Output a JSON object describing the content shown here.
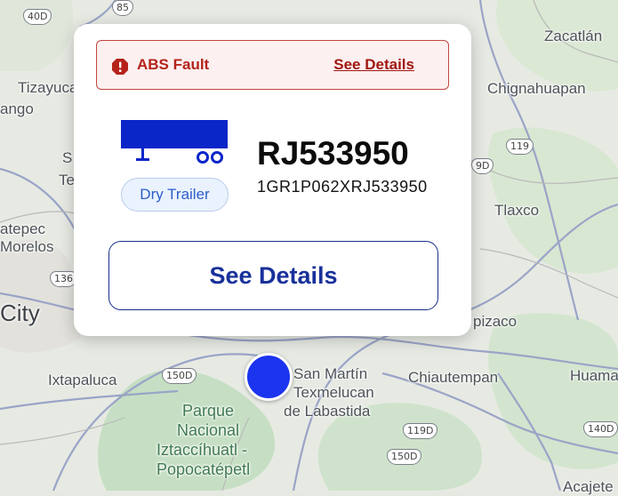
{
  "map": {
    "labels": {
      "tizayuca": "Tizayuca",
      "ango": "ango",
      "ecatepec": "atepec",
      "morelos": "Morelos",
      "city": "City",
      "te": "Te",
      "s": "S",
      "ixtapaluca": "Ixtapaluca",
      "park_line1": "Parque",
      "park_line2": "Nacional",
      "park_line3": "Iztaccíhuatl -",
      "park_line4": "Popocatépetl",
      "san_martin_line1": "San Martín",
      "san_martin_line2": "Texmelucan",
      "san_martin_line3": "de Labastida",
      "chiautempan": "Chiautempan",
      "huamantla": "Huaman",
      "tlaxco": "Tlaxco",
      "chignahuapan": "Chignahuapan",
      "zacatlan": "Zacatlán",
      "apizaco": "pizaco",
      "acajete": "Acajete"
    },
    "shields": {
      "s40d": "40D",
      "s85": "85",
      "s119a": "119",
      "s119d": "119D",
      "s150d_a": "150D",
      "s150d_b": "150D",
      "s140d": "140D",
      "s136": "136",
      "s9d": "9D"
    }
  },
  "alert": {
    "text": "ABS Fault",
    "link": "See Details",
    "color": "#b5231b"
  },
  "vehicle": {
    "icon": "dry-trailer-icon",
    "type": "Dry Trailer",
    "unit_id": "RJ533950",
    "vin": "1GR1P062XRJ533950",
    "icon_color": "#0a26c8"
  },
  "actions": {
    "details_button": "See Details"
  },
  "marker": {
    "color": "#1b34ee"
  }
}
